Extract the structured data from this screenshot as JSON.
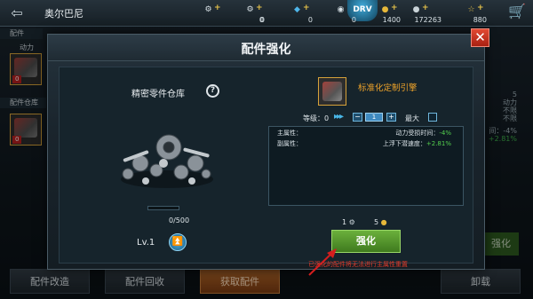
{
  "topbar": {
    "back_icon": "back-arrow-icon",
    "player_name": "奥尔巴尼",
    "resources": [
      {
        "icon": "gear-part-icon",
        "value": "0"
      },
      {
        "icon": "cog-icon",
        "value": "0"
      },
      {
        "icon": "blue-gem-icon",
        "value": "0"
      },
      {
        "icon": "tire-icon",
        "value": "0"
      },
      {
        "icon": "gold-coin-icon",
        "value": "1400"
      },
      {
        "icon": "silver-coin-icon",
        "value": "172263"
      },
      {
        "icon": "star-icon",
        "value": "880"
      }
    ]
  },
  "left_panel": {
    "tab_parts": "配件",
    "power_label": "动力",
    "slot1_count": "0",
    "tab_warehouse": "配件仓库",
    "slot2_count": "0"
  },
  "modal": {
    "title": "配件强化",
    "close": "✕",
    "warehouse_title": "精密零件仓库",
    "help": "?",
    "capacity": "0/500",
    "capacity_fraction": 0.0,
    "level": "Lv.1",
    "part_name": "标准化定制引擎",
    "level_label": "等级：0",
    "level_value": "1",
    "max_label": "最大",
    "main_attr_label": "主属性：",
    "main_attr_value": "动力受损时间：-4%",
    "sub_attr_label": "副属性：",
    "sub_attr_value": "上浮下潜速度：+2.81%",
    "cost_parts": "1",
    "cost_coins": "5",
    "enhance_button": "强化",
    "warning": "已强化的配件将无法进行主属性重置"
  },
  "right_side": {
    "values": [
      "5",
      "动力",
      "不限",
      "不限"
    ],
    "sub1": "间：-4%",
    "sub2": "+2.81%",
    "enhance_ghost": "强化"
  },
  "bottom_bar": {
    "modify": "配件改造",
    "recycle": "配件回收",
    "acquire": "获取配件",
    "unload": "卸载"
  },
  "colors": {
    "accent_orange": "#f0a42a",
    "enhance_green": "#6bb03c",
    "warning_red": "#e23a2a",
    "attr_green": "#54d04e"
  }
}
